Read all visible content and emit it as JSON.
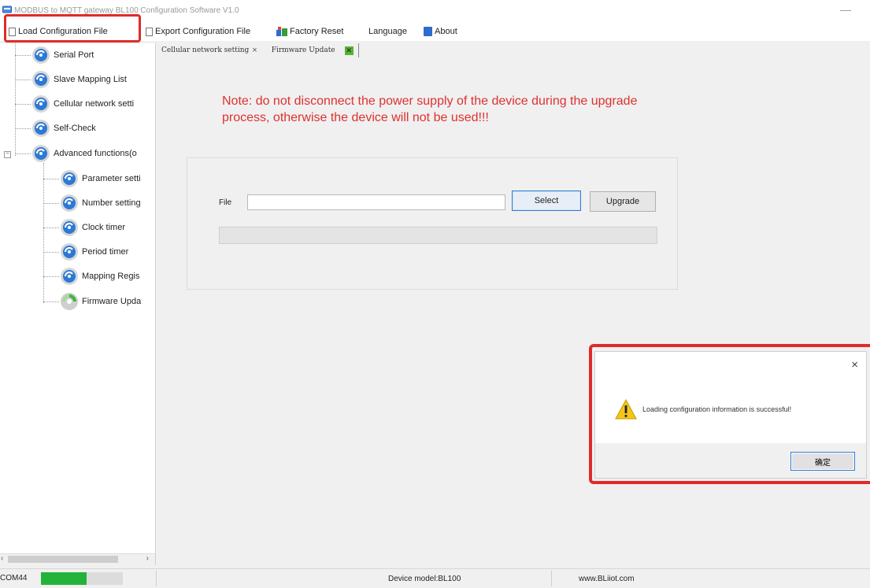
{
  "window": {
    "title": "MODBUS to MQTT gateway BL100 Configuration Software V1.0",
    "minimize_glyph": "—"
  },
  "menu": {
    "load": "Load Configuration File",
    "export": "Export Configuration File",
    "factory_reset": "Factory Reset",
    "language": "Language",
    "about": "About"
  },
  "tree": {
    "items": [
      {
        "label": "Serial Port",
        "icon": "gear-icon"
      },
      {
        "label": "Slave Mapping List",
        "icon": "gear-icon"
      },
      {
        "label": "Cellular network setti",
        "icon": "gear-icon"
      },
      {
        "label": "Self-Check",
        "icon": "gear-icon"
      },
      {
        "label": "Advanced functions(o",
        "icon": "gear-icon"
      }
    ],
    "children": [
      {
        "label": "Parameter setti",
        "icon": "gear-icon"
      },
      {
        "label": "Number setting",
        "icon": "gear-icon"
      },
      {
        "label": "Clock timer",
        "icon": "gear-icon"
      },
      {
        "label": "Period timer",
        "icon": "gear-icon"
      },
      {
        "label": "Mapping Regis",
        "icon": "gear-icon"
      },
      {
        "label": "Firmware Upda",
        "icon": "green-gear-icon"
      }
    ],
    "expander": "−"
  },
  "tabs": [
    {
      "label": "Cellular network setting",
      "close": "×"
    },
    {
      "label": "Firmware Update"
    }
  ],
  "note": "Note: do not disconnect the power supply of the device during the upgrade process, otherwise the device will not be used!!!",
  "upgrade": {
    "file_label": "File",
    "file_value": "",
    "select": "Select",
    "upgrade": "Upgrade",
    "progress": 0
  },
  "dialog": {
    "close": "×",
    "message": "Loading configuration information is successful!",
    "ok": "确定"
  },
  "status": {
    "port": "COM44",
    "model": "Device model:BL100",
    "site": "www.BLiiot.com"
  },
  "colors": {
    "highlight": "#e02a2a",
    "note": "#e03030",
    "led": "#23b33a"
  }
}
